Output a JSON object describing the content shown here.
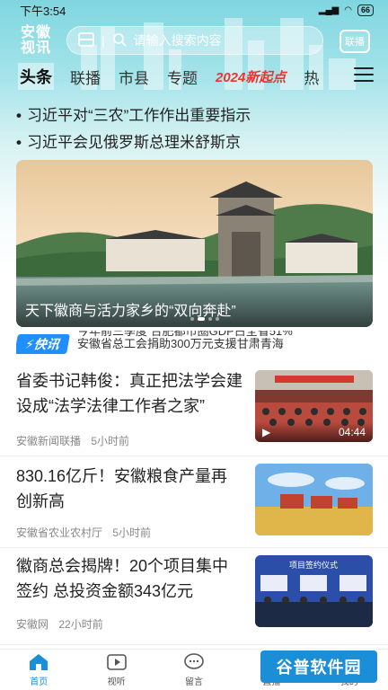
{
  "status": {
    "time": "下午3:54",
    "battery": "66"
  },
  "header": {
    "logo": "安徽\n视讯",
    "search_placeholder": "请输入搜索内容",
    "live_label": "联播"
  },
  "nav": {
    "tabs": [
      "头条",
      "联播",
      "市县",
      "专题",
      "2024新起点",
      "热"
    ],
    "active": "头条"
  },
  "headlines": [
    "习近平对“三农”工作作出重要指示",
    "习近平会见俄罗斯总理米舒斯京"
  ],
  "banner": {
    "caption": "天下徽商与活力家乡的“双向奔赴”"
  },
  "flash": {
    "tag": "快讯",
    "lines": [
      "今年前三季度 合肥都市圈GDP占全省51%",
      "安徽省总工会捐助300万元支援甘肃青海"
    ]
  },
  "news": [
    {
      "title": "省委书记韩俊：真正把法学会建设成“法学法律工作者之家”",
      "source": "安徽新闻联播",
      "time": "5小时前",
      "duration": "04:44"
    },
    {
      "title": "830.16亿斤！安徽粮食产量再创新高",
      "source": "安徽省农业农村厅",
      "time": "5小时前"
    },
    {
      "title": "徽商总会揭牌！20个项目集中签约 总投资金额343亿元",
      "source": "安徽网",
      "time": "22小时前",
      "thumb_text": "项目签约仪式"
    }
  ],
  "bottom_nav": [
    {
      "label": "首页",
      "icon": "home-icon"
    },
    {
      "label": "视听",
      "icon": "play-icon"
    },
    {
      "label": "留言",
      "icon": "chat-icon"
    },
    {
      "label": "直播",
      "icon": "live-icon"
    },
    {
      "label": "我的",
      "icon": "user-icon"
    }
  ],
  "watermark": "谷普软件园",
  "colors": {
    "accent": "#1a8fd8",
    "special_tab": "#e33333",
    "flash_tag": "#1f8fff"
  }
}
